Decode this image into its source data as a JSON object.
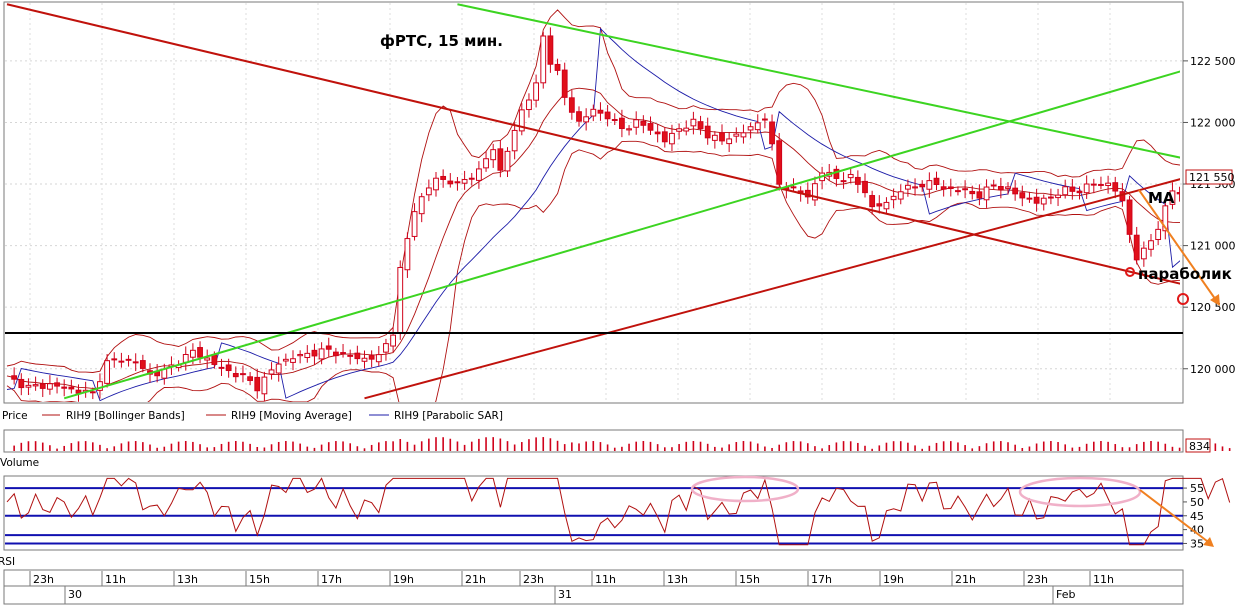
{
  "chart_data": {
    "type": "candlestick",
    "title": "фРТС, 15 мин.",
    "symbol": "RIH9",
    "price_axis": {
      "ticks": [
        120000,
        120500,
        121000,
        121500,
        122000,
        122500
      ],
      "tick_labels": [
        "120 000",
        "120 500",
        "121 000",
        "121 500",
        "122 000",
        "122 500"
      ],
      "ylim": [
        119730,
        122970
      ]
    },
    "last_price": 121550,
    "last_price_label": "121 550",
    "legend": [
      {
        "name": "Price",
        "color": "#d0021b"
      },
      {
        "name": "RIH9 [Bollinger Bands]",
        "color": "#b01010"
      },
      {
        "name": "RIH9 [Moving Average]",
        "color": "#b01010"
      },
      {
        "name": "RIH9 [Parabolic SAR]",
        "color": "#1c1ca8"
      }
    ],
    "close_path": [
      [
        0,
        119930
      ],
      [
        3,
        119850
      ],
      [
        6,
        119870
      ],
      [
        9,
        119830
      ],
      [
        12,
        119800
      ],
      [
        14,
        120050
      ],
      [
        16,
        120080
      ],
      [
        18,
        120050
      ],
      [
        20,
        119950
      ],
      [
        22,
        119980
      ],
      [
        24,
        120060
      ],
      [
        26,
        120140
      ],
      [
        28,
        120080
      ],
      [
        30,
        120000
      ],
      [
        33,
        119940
      ],
      [
        35,
        119850
      ],
      [
        38,
        120050
      ],
      [
        40,
        120090
      ],
      [
        42,
        120120
      ],
      [
        45,
        120150
      ],
      [
        48,
        120100
      ],
      [
        50,
        120080
      ],
      [
        52,
        120100
      ],
      [
        54,
        120300
      ],
      [
        55,
        120800
      ],
      [
        57,
        121300
      ],
      [
        60,
        121550
      ],
      [
        63,
        121500
      ],
      [
        66,
        121600
      ],
      [
        68,
        121800
      ],
      [
        69,
        121600
      ],
      [
        72,
        122100
      ],
      [
        74,
        122300
      ],
      [
        75,
        122700
      ],
      [
        76,
        122500
      ],
      [
        77,
        122400
      ],
      [
        78,
        122200
      ],
      [
        80,
        122000
      ],
      [
        82,
        122100
      ],
      [
        84,
        122050
      ],
      [
        86,
        121950
      ],
      [
        88,
        122000
      ],
      [
        90,
        121950
      ],
      [
        92,
        121850
      ],
      [
        94,
        121950
      ],
      [
        96,
        122000
      ],
      [
        98,
        121900
      ],
      [
        100,
        121850
      ],
      [
        102,
        121900
      ],
      [
        104,
        121950
      ],
      [
        106,
        122050
      ],
      [
        107,
        121800
      ],
      [
        108,
        121500
      ],
      [
        110,
        121450
      ],
      [
        112,
        121400
      ],
      [
        114,
        121600
      ],
      [
        116,
        121550
      ],
      [
        118,
        121550
      ],
      [
        120,
        121450
      ],
      [
        121,
        121300
      ],
      [
        123,
        121350
      ],
      [
        125,
        121450
      ],
      [
        128,
        121500
      ],
      [
        130,
        121500
      ],
      [
        132,
        121450
      ],
      [
        134,
        121450
      ],
      [
        136,
        121400
      ],
      [
        138,
        121500
      ],
      [
        140,
        121450
      ],
      [
        142,
        121400
      ],
      [
        144,
        121350
      ],
      [
        146,
        121400
      ],
      [
        148,
        121450
      ],
      [
        150,
        121450
      ],
      [
        152,
        121500
      ],
      [
        154,
        121500
      ],
      [
        155,
        121450
      ],
      [
        156,
        121350
      ],
      [
        157,
        121100
      ],
      [
        158,
        120900
      ],
      [
        159,
        120950
      ],
      [
        160,
        121050
      ],
      [
        161,
        121150
      ],
      [
        162,
        121300
      ],
      [
        163,
        121450
      ],
      [
        165,
        121400
      ],
      [
        167,
        121550
      ],
      [
        168,
        121450
      ],
      [
        169,
        121500
      ],
      [
        171,
        121550
      ]
    ],
    "trend_lines": [
      {
        "color": "#c0120c",
        "from": [
          0,
          122960
        ],
        "to": [
          175,
          120540
        ]
      },
      {
        "color": "#c0120c",
        "from": [
          50,
          119760
        ],
        "to": [
          175,
          121710
        ]
      },
      {
        "color": "#3cd421",
        "from": [
          8,
          119760
        ],
        "to": [
          175,
          122600
        ]
      },
      {
        "color": "#3cd421",
        "from": [
          63,
          122960
        ],
        "to": [
          175,
          121580
        ]
      }
    ],
    "support_line": 120290,
    "volume": {
      "label": "Volume",
      "last_value_label": "834"
    },
    "rsi": {
      "label": "RSI",
      "ticks": [
        35,
        40,
        45,
        50,
        55
      ],
      "levels": [
        35,
        38,
        45,
        55
      ],
      "ylim": [
        33,
        59
      ]
    },
    "time_axis": {
      "hours": [
        "23h",
        "11h",
        "13h",
        "15h",
        "17h",
        "19h",
        "21h",
        "23h",
        "11h",
        "13h",
        "15h",
        "17h",
        "19h",
        "21h",
        "23h",
        "11h"
      ],
      "dates": [
        "30",
        "31",
        "Feb"
      ]
    },
    "annotations": [
      "MA",
      "параболик"
    ]
  }
}
